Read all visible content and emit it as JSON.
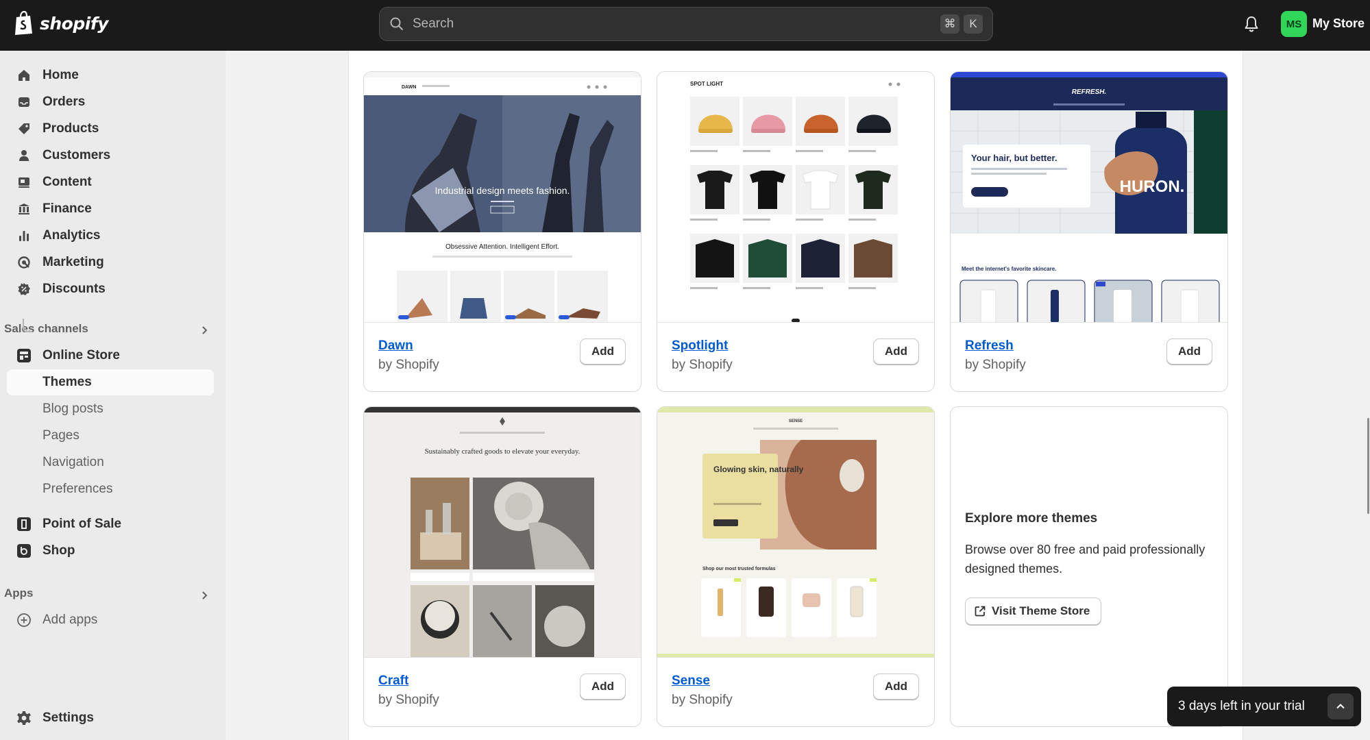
{
  "topbar": {
    "logo_text": "shopify",
    "search_placeholder": "Search",
    "shortcut_keys": [
      "⌘",
      "K"
    ],
    "avatar_initials": "MS",
    "store_name": "My Store",
    "avatar_color": "#2fd658"
  },
  "sidebar": {
    "main_items": [
      {
        "label": "Home",
        "icon": "home-icon"
      },
      {
        "label": "Orders",
        "icon": "inbox-icon"
      },
      {
        "label": "Products",
        "icon": "tag-icon"
      },
      {
        "label": "Customers",
        "icon": "person-icon"
      },
      {
        "label": "Content",
        "icon": "content-icon"
      },
      {
        "label": "Finance",
        "icon": "bank-icon"
      },
      {
        "label": "Analytics",
        "icon": "bar-chart-icon"
      },
      {
        "label": "Marketing",
        "icon": "target-icon"
      },
      {
        "label": "Discounts",
        "icon": "discount-icon"
      }
    ],
    "sales_channels_heading": "Sales channels",
    "online_store": "Online Store",
    "online_store_sub": [
      "Themes",
      "Blog posts",
      "Pages",
      "Navigation",
      "Preferences"
    ],
    "active_sub": "Themes",
    "channels": [
      "Point of Sale",
      "Shop"
    ],
    "apps_heading": "Apps",
    "add_apps": "Add apps",
    "settings": "Settings"
  },
  "themes": [
    {
      "name": "Dawn",
      "by": "by Shopify",
      "add": "Add"
    },
    {
      "name": "Spotlight",
      "by": "by Shopify",
      "add": "Add"
    },
    {
      "name": "Refresh",
      "by": "by Shopify",
      "add": "Add"
    },
    {
      "name": "Craft",
      "by": "by Shopify",
      "add": "Add"
    },
    {
      "name": "Sense",
      "by": "by Shopify",
      "add": "Add"
    }
  ],
  "previews": {
    "dawn": {
      "brand": "DAWN",
      "hero": "Industrial design meets fashion.",
      "tagline": "Obsessive Attention. Intelligent Effort."
    },
    "spotlight": {
      "brand": "SPOT LIGHT"
    },
    "refresh": {
      "brand": "REFRESH.",
      "hero": "Your hair, but better.",
      "bottle": "HURON.",
      "section": "Meet the internet's favorite skincare."
    },
    "craft": {
      "hero": "Sustainably crafted goods to elevate your everyday."
    },
    "sense": {
      "brand": "SENSE",
      "hero": "Glowing skin, naturally",
      "section": "Shop our most trusted formulas"
    }
  },
  "explore": {
    "title": "Explore more themes",
    "body": "Browse over 80 free and paid professionally designed themes.",
    "button": "Visit Theme Store"
  },
  "trial": {
    "text": "3 days left in your trial"
  },
  "colors": {
    "link": "#005bd3",
    "topbar": "#1a1a1a",
    "sidebar": "#ebebeb"
  }
}
